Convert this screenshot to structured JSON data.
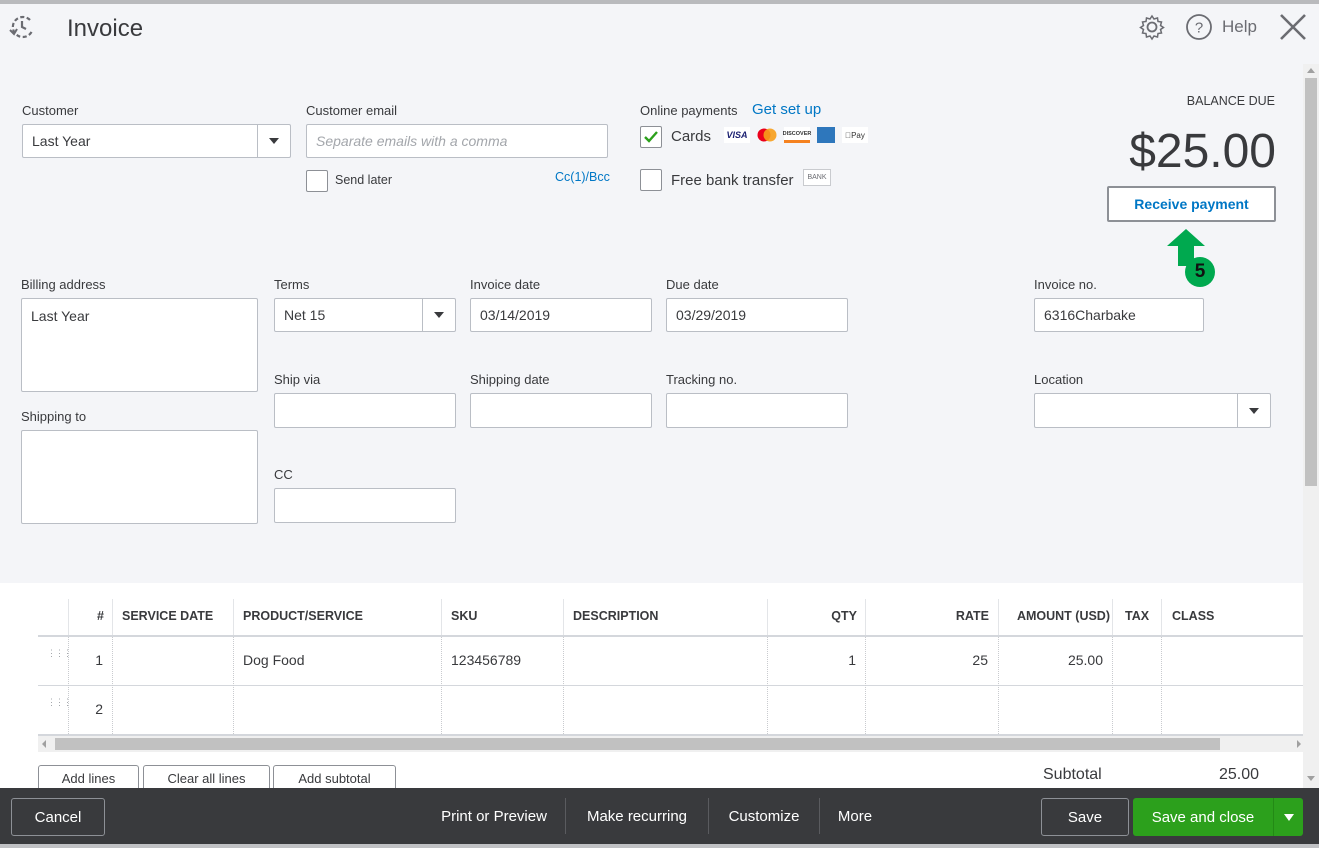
{
  "header": {
    "title": "Invoice",
    "help_label": "Help",
    "icons": [
      "recent-transactions-icon",
      "gear-icon",
      "help-icon",
      "close-icon"
    ]
  },
  "customer": {
    "label": "Customer",
    "value": "Last Year"
  },
  "customer_email": {
    "label": "Customer email",
    "placeholder": "Separate emails with a comma",
    "value": "",
    "send_later_label": "Send later",
    "send_later_checked": false,
    "cc_bcc_link": "Cc(1)/Bcc"
  },
  "online_payments": {
    "label": "Online payments",
    "setup_link": "Get set up",
    "cards_label": "Cards",
    "cards_checked": true,
    "card_logos": [
      "VISA",
      "MasterCard",
      "DISCOVER",
      "AMEX",
      "Apple Pay"
    ],
    "bank_label": "Free bank transfer",
    "bank_checked": false,
    "bank_badge": "BANK"
  },
  "balance": {
    "label": "BALANCE DUE",
    "amount": "$25.00",
    "receive_payment_label": "Receive payment"
  },
  "annotation": {
    "step_number": "5",
    "color": "#00a94f"
  },
  "fields": {
    "billing_address": {
      "label": "Billing address",
      "value": "Last Year"
    },
    "shipping_to": {
      "label": "Shipping to",
      "value": ""
    },
    "terms": {
      "label": "Terms",
      "value": "Net 15"
    },
    "invoice_date": {
      "label": "Invoice date",
      "value": "03/14/2019"
    },
    "due_date": {
      "label": "Due date",
      "value": "03/29/2019"
    },
    "invoice_no": {
      "label": "Invoice no.",
      "value": "6316Charbake"
    },
    "ship_via": {
      "label": "Ship via",
      "value": ""
    },
    "shipping_date": {
      "label": "Shipping date",
      "value": ""
    },
    "tracking_no": {
      "label": "Tracking no.",
      "value": ""
    },
    "location": {
      "label": "Location",
      "value": ""
    },
    "cc": {
      "label": "CC",
      "value": ""
    }
  },
  "table": {
    "columns": [
      "#",
      "SERVICE DATE",
      "PRODUCT/SERVICE",
      "SKU",
      "DESCRIPTION",
      "QTY",
      "RATE",
      "AMOUNT (USD)",
      "TAX",
      "CLASS"
    ],
    "rows": [
      {
        "num": "1",
        "service_date": "",
        "product": "Dog Food",
        "sku": "123456789",
        "description": "",
        "qty": "1",
        "rate": "25",
        "amount": "25.00",
        "tax": "",
        "class": ""
      },
      {
        "num": "2",
        "service_date": "",
        "product": "",
        "sku": "",
        "description": "",
        "qty": "",
        "rate": "",
        "amount": "",
        "tax": "",
        "class": ""
      }
    ]
  },
  "line_actions": {
    "add_lines": "Add lines",
    "clear_all_lines": "Clear all lines",
    "add_subtotal": "Add subtotal"
  },
  "totals": {
    "subtotal_label": "Subtotal",
    "subtotal_value": "25.00"
  },
  "footer": {
    "cancel": "Cancel",
    "print_preview": "Print or Preview",
    "make_recurring": "Make recurring",
    "customize": "Customize",
    "more": "More",
    "save": "Save",
    "save_and_close": "Save and close",
    "accent": "#2ca01c"
  }
}
